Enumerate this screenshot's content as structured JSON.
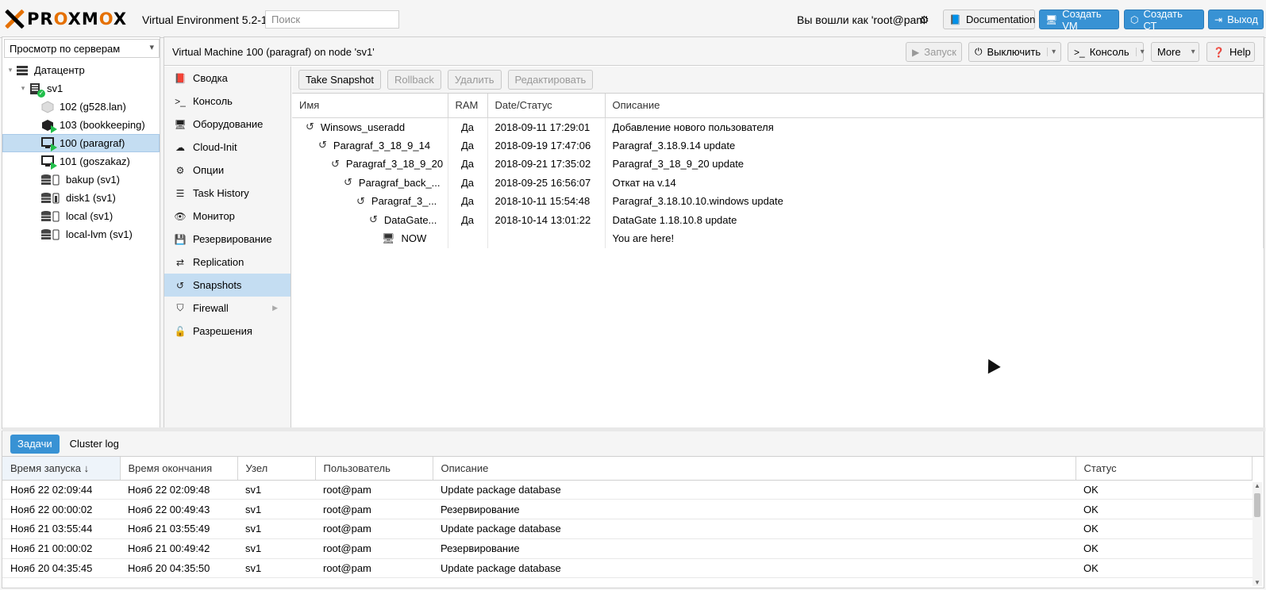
{
  "header": {
    "logo_text_a": "PR",
    "logo_text_o1": "O",
    "logo_text_b": "XM",
    "logo_text_o2": "O",
    "logo_text_c": "X",
    "version": "Virtual Environment 5.2-1",
    "search_placeholder": "Поиск",
    "logged_in": "Вы вошли как 'root@pam'",
    "documentation": "Documentation",
    "create_vm": "Создать VM",
    "create_ct": "Создать СТ",
    "logout": "Выход"
  },
  "left": {
    "view_select": "Просмотр по серверам",
    "tree": [
      {
        "label": "Датацентр",
        "icon": "datacenter-icon"
      },
      {
        "label": "sv1",
        "icon": "server-icon"
      },
      {
        "label": "102 (g528.lan)",
        "icon": "container-icon"
      },
      {
        "label": "103 (bookkeeping)",
        "icon": "container-running-icon"
      },
      {
        "label": "100 (paragraf)",
        "icon": "vm-running-icon"
      },
      {
        "label": "101 (goszakaz)",
        "icon": "vm-running-icon"
      },
      {
        "label": "bakup (sv1)",
        "icon": "storage-icon"
      },
      {
        "label": "disk1 (sv1)",
        "icon": "storage-icon"
      },
      {
        "label": "local (sv1)",
        "icon": "storage-icon"
      },
      {
        "label": "local-lvm (sv1)",
        "icon": "storage-icon"
      }
    ]
  },
  "vm": {
    "title": "Virtual Machine 100 (paragraf) on node 'sv1'",
    "start": "Запуск",
    "shutdown": "Выключить",
    "console": "Консоль",
    "more": "More",
    "help": "Help"
  },
  "nav": [
    {
      "label": "Сводка",
      "icon": "book-icon"
    },
    {
      "label": "Консоль",
      "icon": "terminal-icon"
    },
    {
      "label": "Оборудование",
      "icon": "desktop-icon"
    },
    {
      "label": "Cloud-Init",
      "icon": "cloud-icon"
    },
    {
      "label": "Опции",
      "icon": "gear-icon"
    },
    {
      "label": "Task History",
      "icon": "list-icon"
    },
    {
      "label": "Монитор",
      "icon": "eye-icon"
    },
    {
      "label": "Резервирование",
      "icon": "floppy-icon"
    },
    {
      "label": "Replication",
      "icon": "retweet-icon"
    },
    {
      "label": "Snapshots",
      "icon": "history-icon"
    },
    {
      "label": "Firewall",
      "icon": "shield-icon"
    },
    {
      "label": "Разрешения",
      "icon": "unlock-icon"
    }
  ],
  "snapshots": {
    "toolbar": {
      "take": "Take Snapshot",
      "rollback": "Rollback",
      "delete": "Удалить",
      "edit": "Редактировать"
    },
    "columns": [
      "Имя",
      "RAM",
      "Date/Статус",
      "Описание"
    ],
    "rows": [
      {
        "name": "Winsows_useradd",
        "ram": "Да",
        "date": "2018-09-11 17:29:01",
        "desc": "Добавление нового пользователя"
      },
      {
        "name": "Paragraf_3_18_9_14",
        "ram": "Да",
        "date": "2018-09-19 17:47:06",
        "desc": "Paragraf_3.18.9.14 update"
      },
      {
        "name": "Paragraf_3_18_9_20",
        "ram": "Да",
        "date": "2018-09-21 17:35:02",
        "desc": "Paragraf_3_18_9_20 update"
      },
      {
        "name": "Paragraf_back_...",
        "ram": "Да",
        "date": "2018-09-25 16:56:07",
        "desc": "Откат на v.14"
      },
      {
        "name": "Paragraf_3_...",
        "ram": "Да",
        "date": "2018-10-11 15:54:48",
        "desc": "Paragraf_3.18.10.10.windows update"
      },
      {
        "name": "DataGate...",
        "ram": "Да",
        "date": "2018-10-14 13:01:22",
        "desc": "DataGate 1.18.10.8 update"
      },
      {
        "name": "NOW",
        "ram": "",
        "date": "",
        "desc": "You are here!"
      }
    ]
  },
  "tasks": {
    "tab_tasks": "Задачи",
    "tab_cluster": "Cluster log",
    "columns": [
      "Время запуска ↓",
      "Время окончания",
      "Узел",
      "Пользователь",
      "Описание",
      "Статус"
    ],
    "rows": [
      [
        "Нояб 22 02:09:44",
        "Нояб 22 02:09:48",
        "sv1",
        "root@pam",
        "Update package database",
        "OK"
      ],
      [
        "Нояб 22 00:00:02",
        "Нояб 22 00:49:43",
        "sv1",
        "root@pam",
        "Резервирование",
        "OK"
      ],
      [
        "Нояб 21 03:55:44",
        "Нояб 21 03:55:49",
        "sv1",
        "root@pam",
        "Update package database",
        "OK"
      ],
      [
        "Нояб 21 00:00:02",
        "Нояб 21 00:49:42",
        "sv1",
        "root@pam",
        "Резервирование",
        "OK"
      ],
      [
        "Нояб 20 04:35:45",
        "Нояб 20 04:35:50",
        "sv1",
        "root@pam",
        "Update package database",
        "OK"
      ]
    ]
  },
  "colors": {
    "accent": "#3892d4",
    "selected": "#c4ddf2",
    "running": "#21bf4b",
    "brand_orange": "#e57000"
  }
}
